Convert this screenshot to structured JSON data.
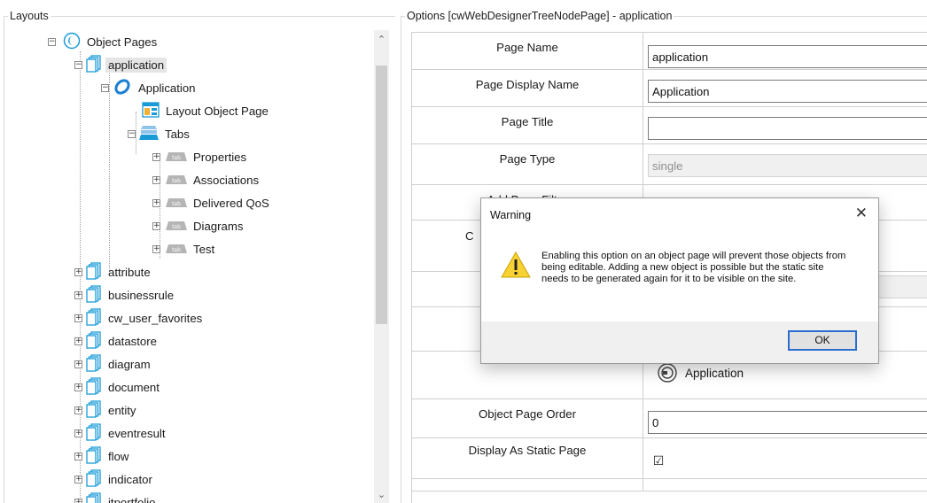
{
  "layouts_panel": {
    "title": "Layouts",
    "tree": {
      "object_pages": "Object Pages",
      "application_page": "application",
      "application_object": "Application",
      "layout_object_page": "Layout Object Page",
      "tabs": "Tabs",
      "tab_properties": "Properties",
      "tab_associations": "Associations",
      "tab_delivered_qos": "Delivered QoS",
      "tab_diagrams": "Diagrams",
      "tab_test": "Test",
      "tab_icon_text": "tab",
      "pages": [
        "attribute",
        "businessrule",
        "cw_user_favorites",
        "datastore",
        "diagram",
        "document",
        "entity",
        "eventresult",
        "flow",
        "indicator",
        "itportfolio"
      ]
    }
  },
  "options_panel": {
    "title": "Options [cwWebDesignerTreeNodePage] - application",
    "rows": {
      "page_name": {
        "label": "Page Name",
        "value": "application"
      },
      "page_display_name": {
        "label": "Page Display Name",
        "value": "Application"
      },
      "page_title": {
        "label": "Page Title",
        "value": ""
      },
      "page_type": {
        "label": "Page Type",
        "value": "single"
      },
      "add_page_filter": {
        "label": "Add Page Filter"
      },
      "obscured_label": "C",
      "object_type_value": "Application",
      "object_page_order": {
        "label": "Object Page Order",
        "value": "0"
      },
      "display_as_static_page": {
        "label": "Display As Static Page",
        "checked_glyph": "☑"
      }
    }
  },
  "dialog": {
    "title": "Warning",
    "message": "Enabling this option on an object page will prevent those objects from being editable. Adding a new object is possible but the static site needs to be generated again for it to be visible on the site.",
    "ok_label": "OK",
    "close_glyph": "✕"
  },
  "colors": {
    "page_icon": "#1a9bd7",
    "warning_yellow": "#f8d233",
    "focus_blue": "#2a6dd0"
  }
}
